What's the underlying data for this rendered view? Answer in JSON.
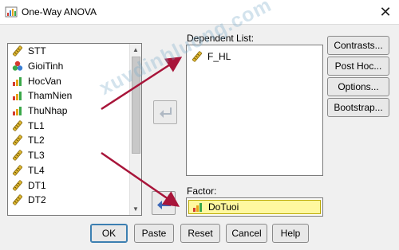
{
  "window": {
    "title": "One-Way ANOVA",
    "close_glyph": "✕"
  },
  "variables": [
    {
      "name": "STT",
      "icon": "ruler-icon"
    },
    {
      "name": "GioiTinh",
      "icon": "nominal-icon"
    },
    {
      "name": "HocVan",
      "icon": "ordinal-icon"
    },
    {
      "name": "ThamNien",
      "icon": "ordinal-icon"
    },
    {
      "name": "ThuNhap",
      "icon": "ordinal-icon"
    },
    {
      "name": "TL1",
      "icon": "ruler-icon"
    },
    {
      "name": "TL2",
      "icon": "ruler-icon"
    },
    {
      "name": "TL3",
      "icon": "ruler-icon"
    },
    {
      "name": "TL4",
      "icon": "ruler-icon"
    },
    {
      "name": "DT1",
      "icon": "ruler-icon"
    },
    {
      "name": "DT2",
      "icon": "ruler-icon"
    }
  ],
  "dependent": {
    "label": "Dependent List:",
    "items": [
      {
        "name": "F_HL",
        "icon": "ruler-icon"
      }
    ]
  },
  "factor": {
    "label": "Factor:",
    "value": "DoTuoi",
    "icon": "ordinal-icon"
  },
  "side_buttons": [
    "Contrasts...",
    "Post Hoc...",
    "Options...",
    "Bootstrap..."
  ],
  "bottom_buttons": [
    "OK",
    "Paste",
    "Reset",
    "Cancel",
    "Help"
  ],
  "watermark": "xuvdinhluong.com",
  "colors": {
    "annotation": "#a8153a",
    "factor_highlight": "#fff8a0"
  }
}
